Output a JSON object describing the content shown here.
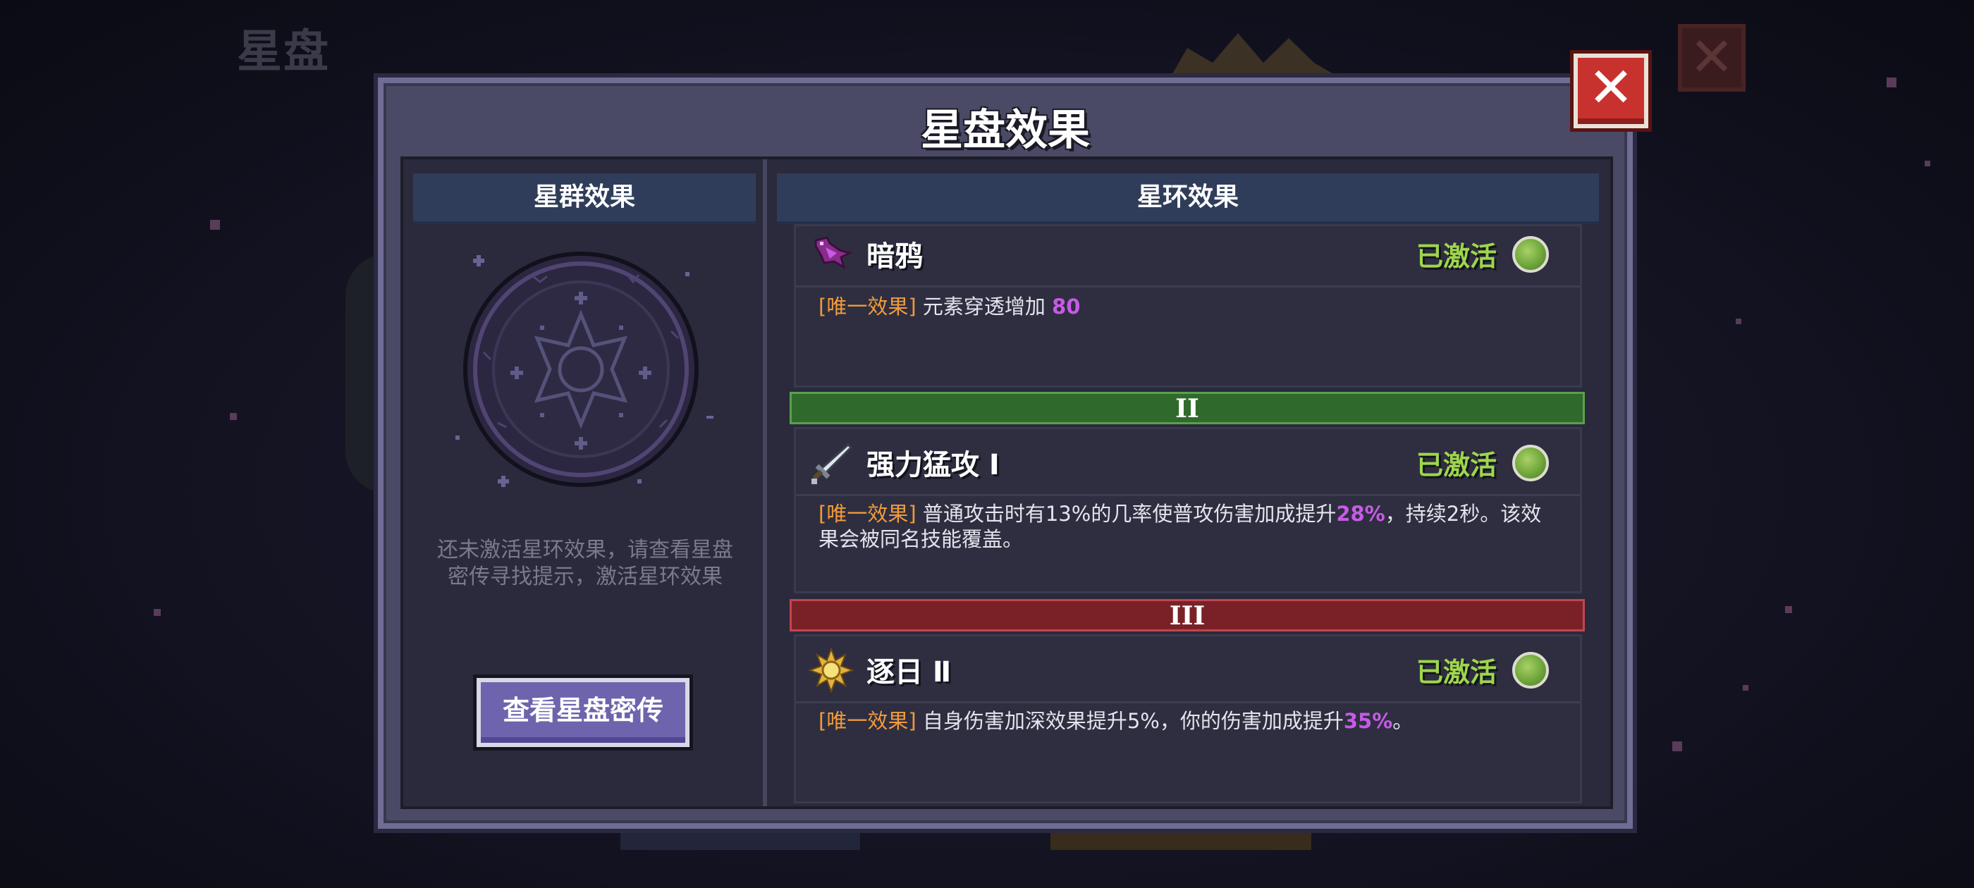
{
  "background": {
    "title": "星盘",
    "close_glyph": "✕"
  },
  "dialog": {
    "title": "星盘效果",
    "close_glyph": "✕",
    "close_icon": "close-icon"
  },
  "constellation_panel": {
    "header": "星群效果",
    "hint_line1": "还未激活星环效果，请查看星盘",
    "hint_line2": "密传寻找提示，激活星环效果",
    "button_label": "查看星盘密传",
    "sigil_icon": "star-chart-sigil-icon"
  },
  "ring_panel": {
    "header": "星环效果",
    "tiers": [
      "II",
      "III"
    ],
    "effects": [
      {
        "icon": "raven-icon",
        "name": "暗鸦",
        "status": "已激活",
        "tag": "[唯一效果]",
        "desc_parts": [
          " 元素穿透增加 ",
          "80",
          ""
        ],
        "highlight": "80"
      },
      {
        "icon": "sword-icon",
        "name": "强力猛攻 Ⅰ",
        "status": "已激活",
        "tag": "[唯一效果]",
        "desc_line1_a": " 普通攻击时有13%的几率使普攻伤害加成提升",
        "desc_line1_hl": "28%",
        "desc_line1_b": "，持续2秒。该效",
        "desc_line2": "果会被同名技能覆盖。"
      },
      {
        "icon": "sun-icon",
        "name": "逐日 Ⅱ",
        "status": "已激活",
        "tag": "[唯一效果]",
        "desc_a": " 自身伤害加深效果提升5%，你的伤害加成提升",
        "desc_hl": "35%",
        "desc_b": "。"
      }
    ]
  },
  "colors": {
    "active_status": "#9fd64c",
    "tag_orange": "#f09b3b",
    "highlight_purple": "#c65be6",
    "tier2_green": "#2f6a2c",
    "tier3_red": "#7a2128"
  }
}
